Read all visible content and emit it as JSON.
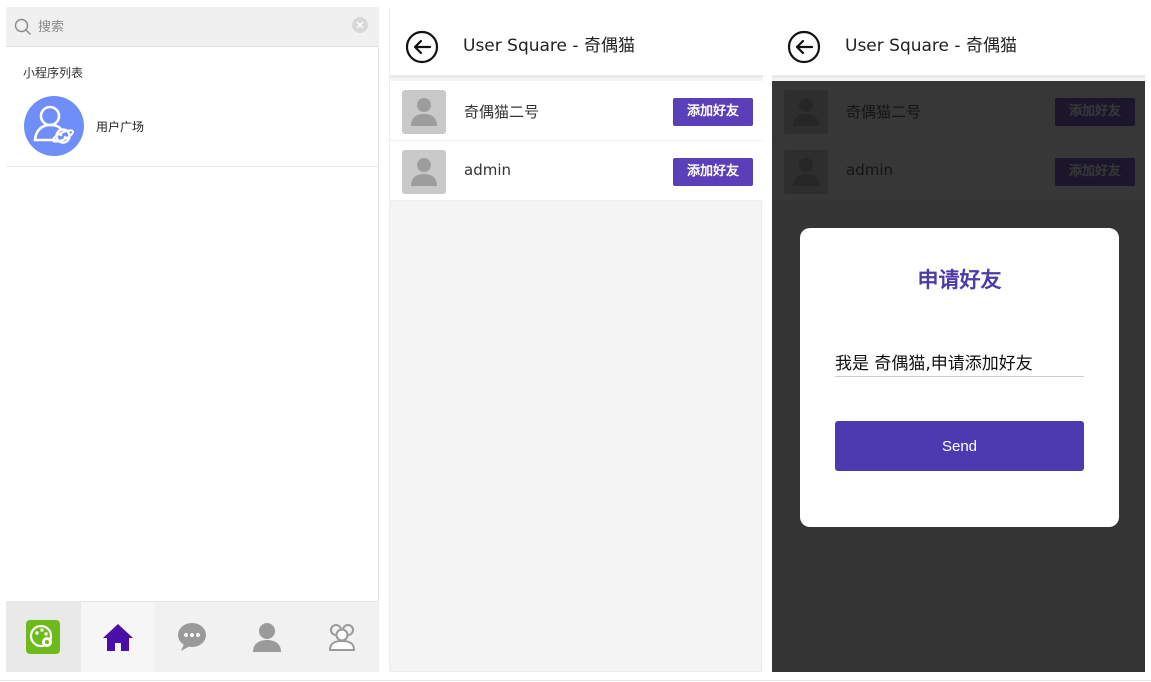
{
  "colors": {
    "accent": "#5b3fb8",
    "dialog_title": "#4e3aa8",
    "avatar_bg": "#6f8ef7",
    "home_active": "#4a0fa6"
  },
  "miniapp_list": {
    "search": {
      "placeholder": "搜索",
      "icon": "search-icon",
      "clear_icon": "clear-icon"
    },
    "section_label": "小程序列表",
    "items": [
      {
        "label": "用户广场",
        "icon": "user-planet-icon"
      }
    ],
    "tabbar": [
      {
        "name": "brand",
        "icon": "palette-icon"
      },
      {
        "name": "home",
        "icon": "home-icon",
        "active": true
      },
      {
        "name": "chat",
        "icon": "chat-bubble-icon"
      },
      {
        "name": "profile",
        "icon": "person-icon"
      },
      {
        "name": "contacts",
        "icon": "group-icon"
      }
    ]
  },
  "user_square": {
    "title": "User Square - 奇偶猫",
    "users": [
      {
        "name": "奇偶猫二号",
        "action": "添加好友"
      },
      {
        "name": "admin",
        "action": "添加好友"
      }
    ]
  },
  "dialog": {
    "title": "申请好友",
    "message_value": "我是 奇偶猫,申请添加好友",
    "send_label": "Send"
  }
}
